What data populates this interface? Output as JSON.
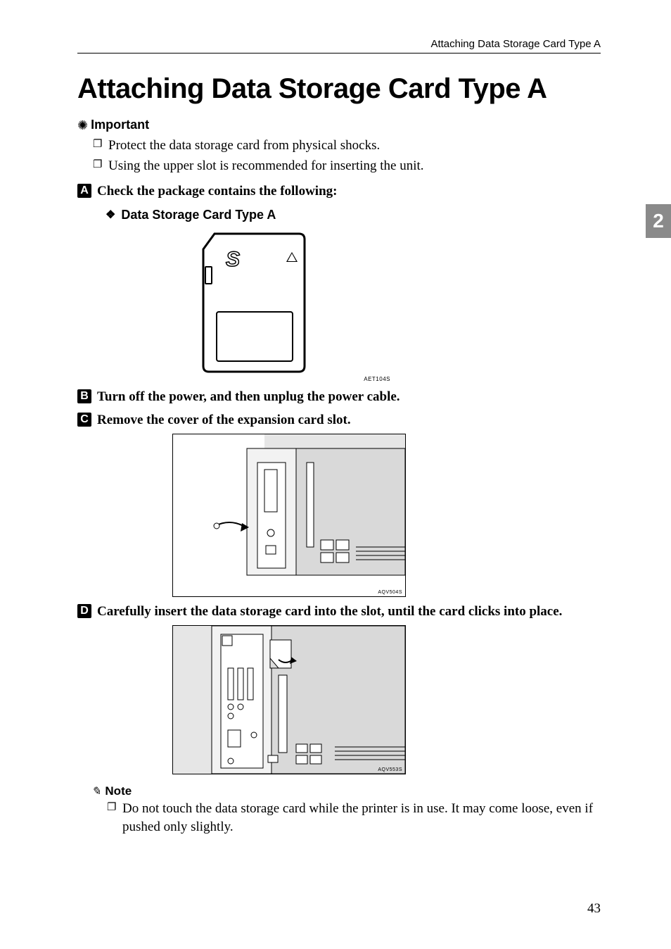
{
  "header": {
    "running_title": "Attaching Data Storage Card Type A"
  },
  "section_tab": "2",
  "title": "Attaching Data Storage Card Type A",
  "important": {
    "label": "Important",
    "items": [
      "Protect the data storage card from physical shocks.",
      "Using the upper slot is recommended for inserting the unit."
    ]
  },
  "steps": {
    "s1": {
      "num": "A",
      "text": "Check the package contains the following:"
    },
    "s1_sub_heading": "Data Storage Card Type A",
    "fig1_code": "AET104S",
    "s2": {
      "num": "B",
      "text": "Turn off the power, and then unplug the power cable."
    },
    "s3": {
      "num": "C",
      "text": "Remove the cover of the expansion card slot."
    },
    "fig2_code": "AQV504S",
    "s4": {
      "num": "D",
      "text": "Carefully insert the data storage card into the slot, until the card clicks into place."
    },
    "fig3_code": "AQV553S"
  },
  "note": {
    "label": "Note",
    "items": [
      "Do not touch the data storage card while the printer is in use. It may come loose, even if pushed only slightly."
    ]
  },
  "page_number": "43"
}
